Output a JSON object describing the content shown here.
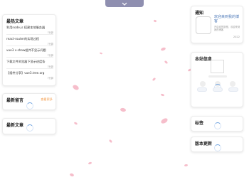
{
  "top_toggle": {
    "icon": "chevron-down-icon"
  },
  "latest_articles": {
    "title": "最热文章",
    "items": [
      {
        "title": "利用node.js 搭建本地服务器",
        "date": "7分钟"
      },
      {
        "title": "react-router的实现过程",
        "date": "7分钟"
      },
      {
        "title": "vue3 v-show组件不显示问题",
        "date": "7分钟"
      },
      {
        "title": "下载文件浏览器下显示进度条",
        "date": "7分钟"
      },
      {
        "title": "【插件分享】vue3.tree.org",
        "date": "7分钟"
      }
    ]
  },
  "latest_comments": {
    "title": "最新留言",
    "more": "查看更多"
  },
  "newest_articles": {
    "title": "最新文章"
  },
  "notice": {
    "title": "通知",
    "headline": "欢迎来到我的博客",
    "sub": "开启你的旅程，欢迎来到我的博客",
    "year": "2022"
  },
  "site_info": {
    "title": "本站信息"
  },
  "tags": {
    "title": "标签"
  },
  "version": {
    "title": "版本更新"
  },
  "colors": {
    "accent": "#4d79b8",
    "petal": "#f4b3c2",
    "more": "#f39c4a"
  }
}
